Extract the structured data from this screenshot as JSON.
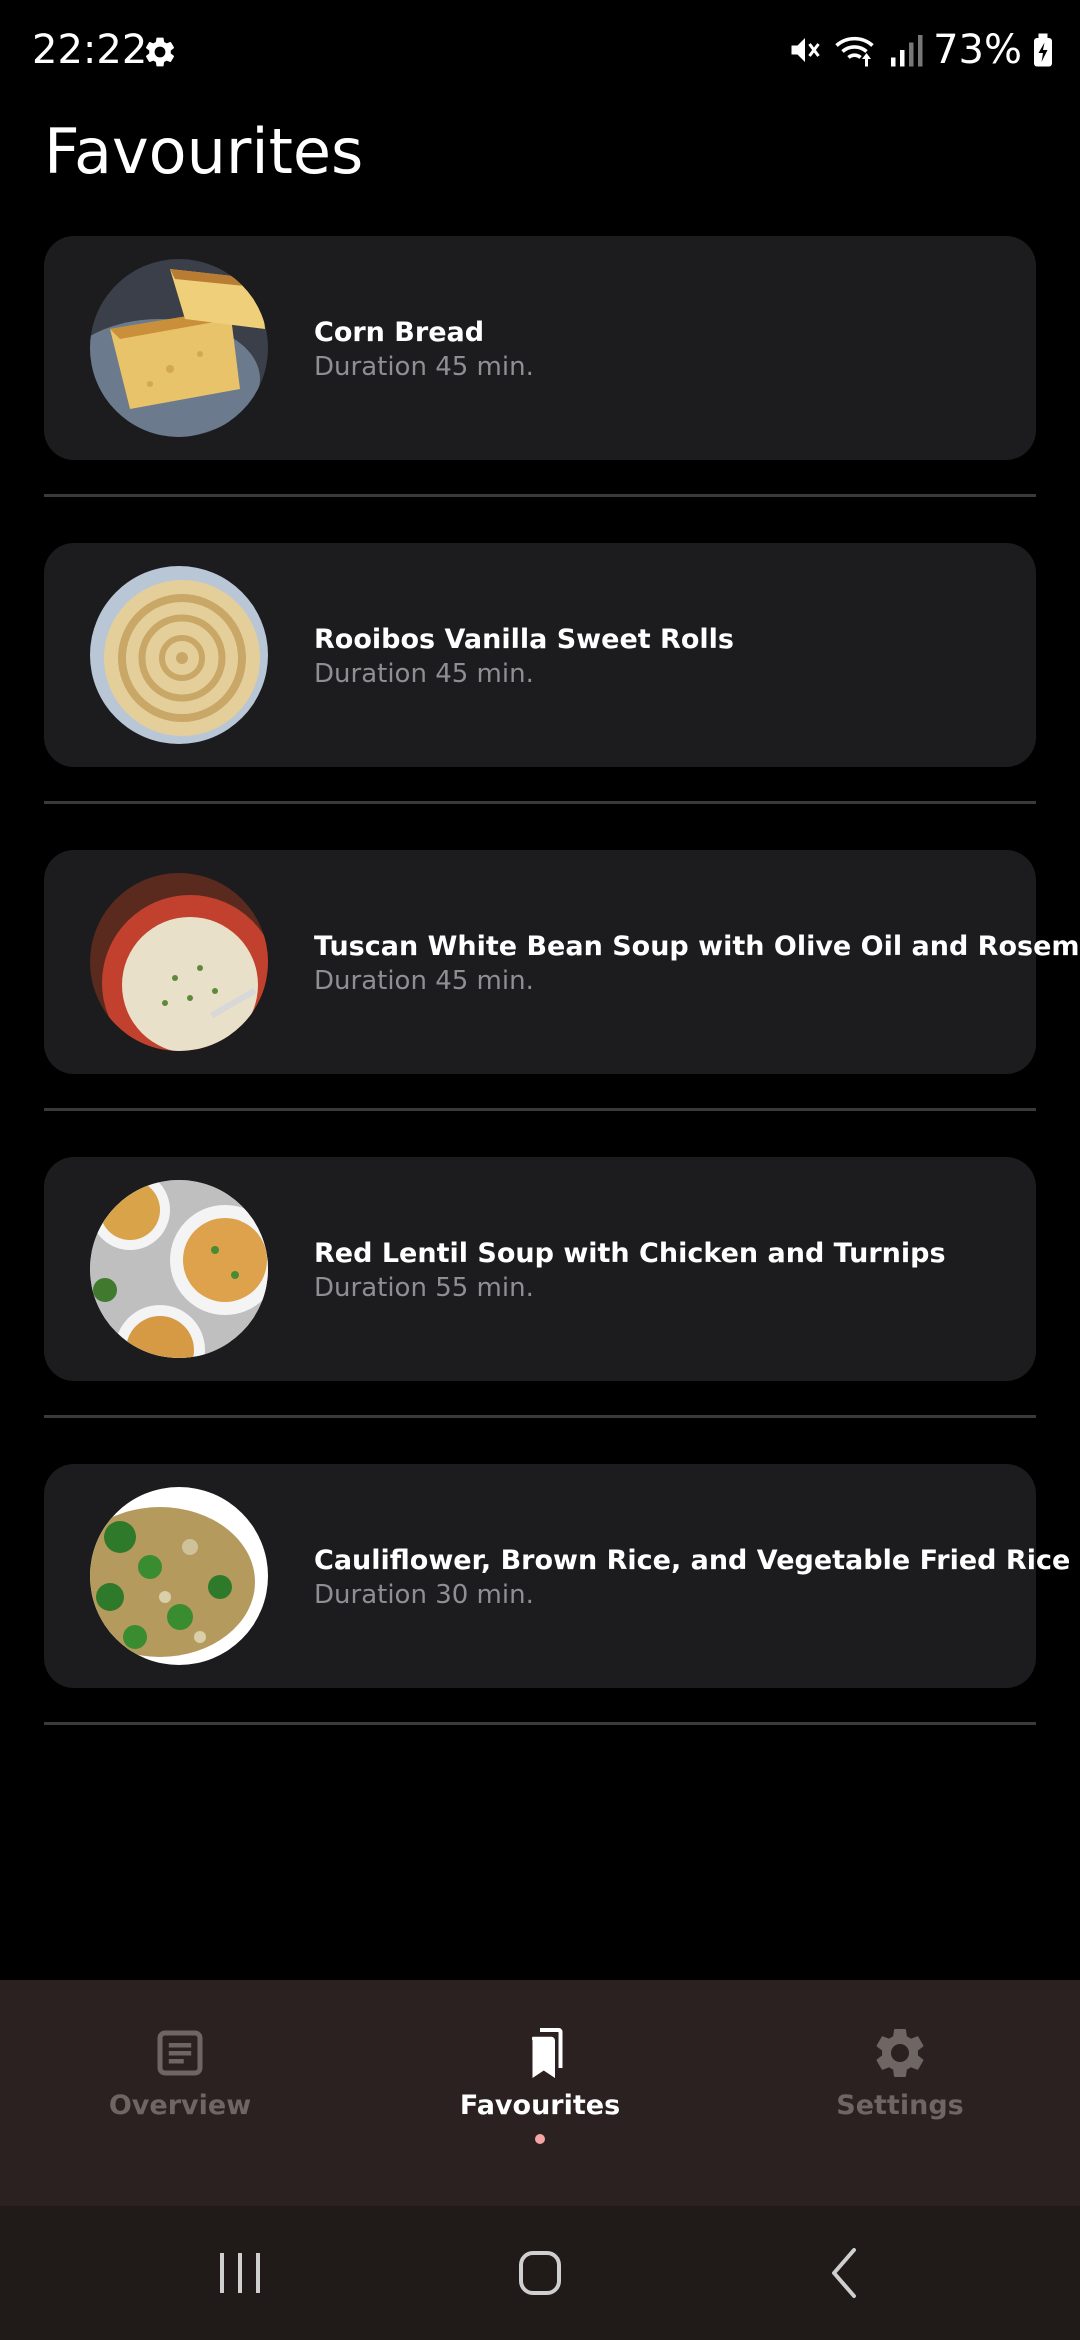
{
  "status_bar": {
    "time": "22:22",
    "battery_percent": "73%",
    "icons": [
      "settings-gear-icon",
      "mute-icon",
      "wifi-icon",
      "cellular-signal-icon",
      "battery-charging-icon"
    ]
  },
  "page": {
    "title": "Favourites"
  },
  "recipes": [
    {
      "name": "Corn Bread",
      "duration": "Duration 45 min."
    },
    {
      "name": "Rooibos Vanilla Sweet Rolls",
      "duration": "Duration 45 min."
    },
    {
      "name": "Tuscan White Bean Soup with Olive Oil and Rosemary",
      "duration": "Duration 45 min."
    },
    {
      "name": "Red Lentil Soup with Chicken and Turnips",
      "duration": "Duration 55 min."
    },
    {
      "name": "Cauliflower, Brown Rice, and Vegetable Fried Rice",
      "duration": "Duration 30 min."
    }
  ],
  "bottom_nav": {
    "items": [
      {
        "label": "Overview",
        "icon": "article-icon",
        "active": false
      },
      {
        "label": "Favourites",
        "icon": "bookmarks-icon",
        "active": true
      },
      {
        "label": "Settings",
        "icon": "gear-icon",
        "active": false
      }
    ]
  },
  "system_nav": {
    "buttons": [
      "recents-icon",
      "home-icon",
      "back-icon"
    ]
  },
  "colors": {
    "background": "#000000",
    "card": "#1c1c1e",
    "divider": "#3a3a3c",
    "secondary_text": "#8e8e93",
    "nav_background": "#2a2120",
    "nav_inactive": "#6e6663",
    "nav_indicator": "#f4a6a6"
  }
}
